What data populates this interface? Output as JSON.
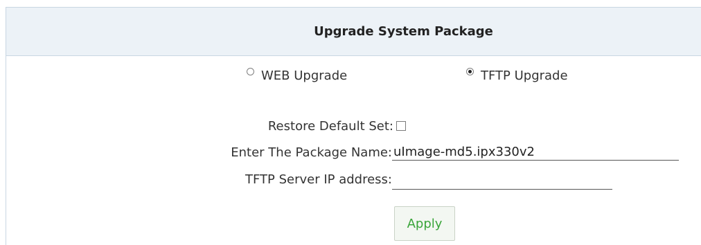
{
  "panel": {
    "title": "Upgrade System Package"
  },
  "upgrade_mode": {
    "options": [
      {
        "label": "WEB Upgrade",
        "checked": false
      },
      {
        "label": "TFTP Upgrade",
        "checked": true
      }
    ]
  },
  "form": {
    "restore_default_label": "Restore Default Set:",
    "restore_default_checked": false,
    "package_name_label": "Enter The Package Name:",
    "package_name_value": "uImage-md5.ipx330v2",
    "tftp_ip_label": "TFTP Server IP address:",
    "tftp_ip_value": ""
  },
  "actions": {
    "apply_label": "Apply"
  },
  "colors": {
    "header_bg": "#ecf2f7",
    "border": "#c8d6e2",
    "apply_text": "#3aa53a"
  }
}
